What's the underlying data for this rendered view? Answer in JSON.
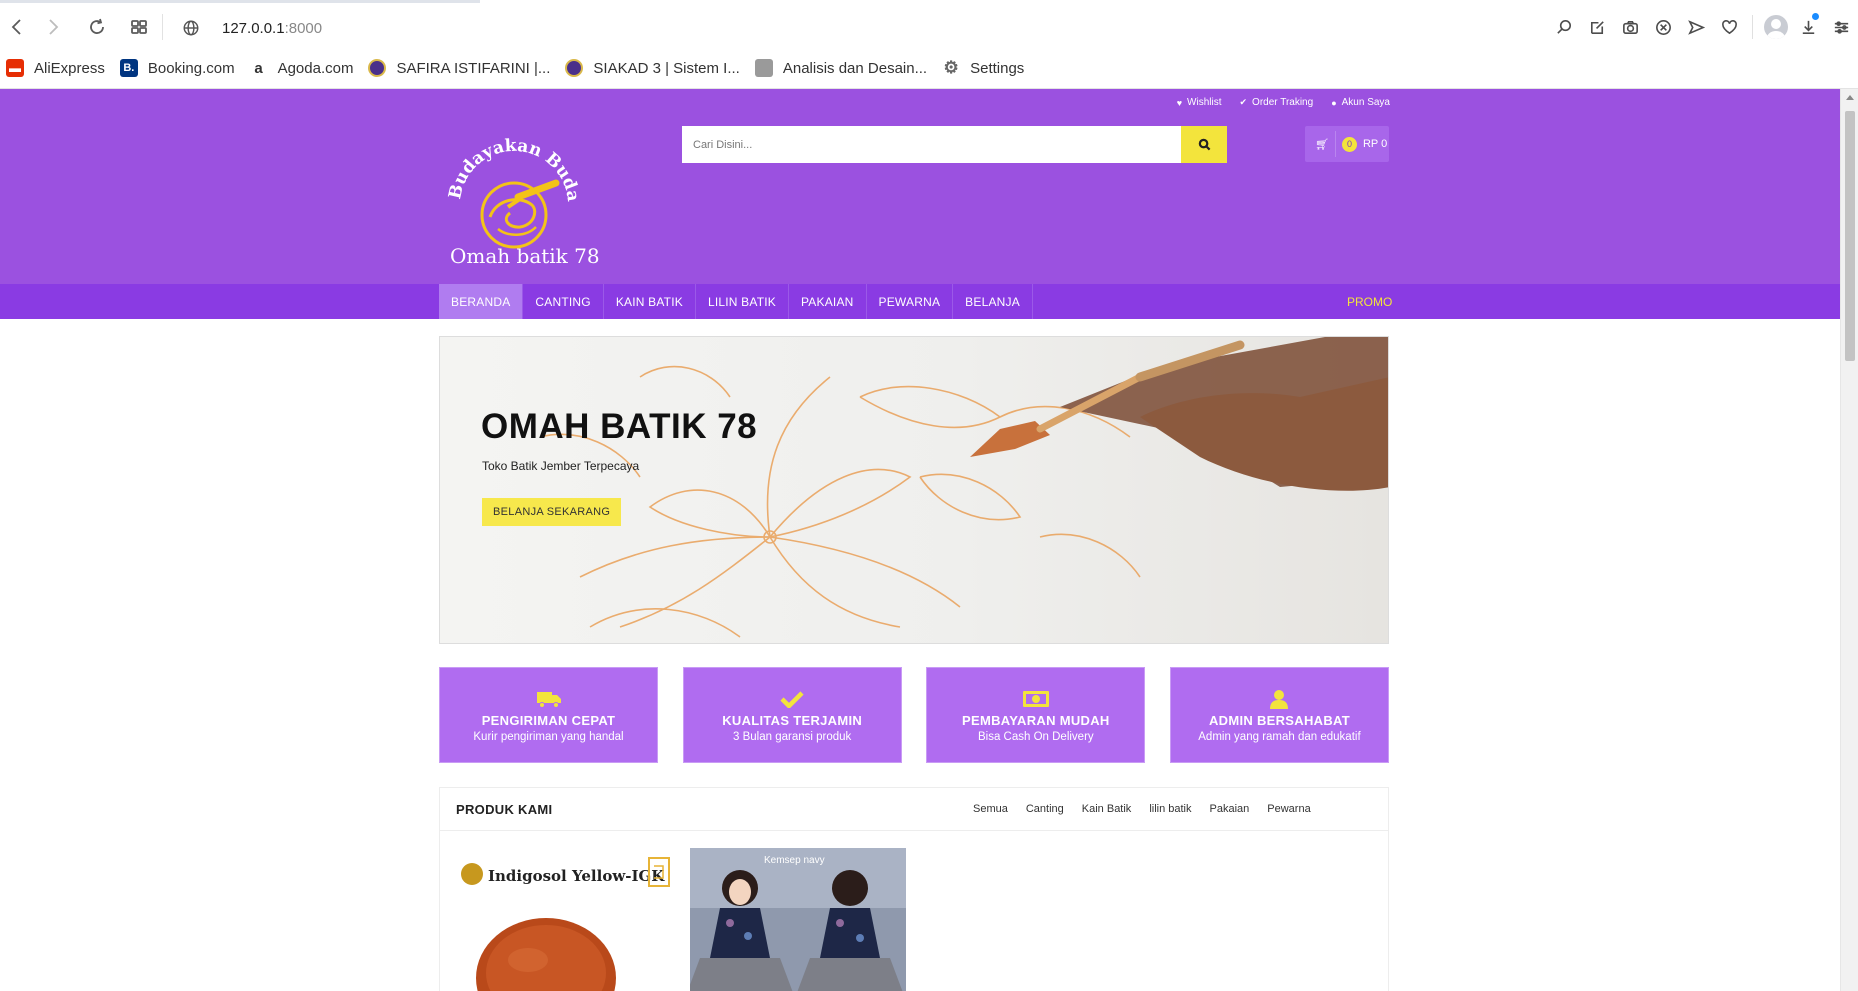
{
  "browser": {
    "address_host": "127.0.0.1",
    "address_port": ":8000",
    "bookmarks": [
      {
        "label": "AliExpress",
        "color": "#e62e04",
        "glyph": "◧"
      },
      {
        "label": "Booking.com",
        "color": "#003580",
        "glyph": "B."
      },
      {
        "label": "Agoda.com",
        "color": "#ffffff",
        "glyph": "a"
      },
      {
        "label": "SAFIRA ISTIFARINI |...",
        "color": "#3b2a7a",
        "glyph": "●"
      },
      {
        "label": "SIAKAD 3 | Sistem I...",
        "color": "#3b2a7a",
        "glyph": "●"
      },
      {
        "label": "Analisis dan Desain...",
        "color": "#9a9a9a",
        "glyph": "▤"
      },
      {
        "label": "Settings",
        "color": "#ffffff",
        "glyph": "⚙"
      }
    ]
  },
  "header": {
    "topnav": {
      "wishlist": "Wishlist",
      "order": "Order Traking",
      "account": "Akun Saya"
    },
    "search_placeholder": "Cari Disini...",
    "cart": {
      "count": "0",
      "total": "RP 0"
    },
    "logo": {
      "arc_text": "Budayakan Budaya",
      "bottom_text": "Omah batik 78"
    }
  },
  "nav": {
    "items": [
      "BERANDA",
      "CANTING",
      "KAIN BATIK",
      "LILIN BATIK",
      "PAKAIAN",
      "PEWARNA",
      "BELANJA"
    ],
    "promo": "PROMO"
  },
  "hero": {
    "title": "OMAH BATIK 78",
    "subtitle": "Toko Batik Jember Terpecaya",
    "button": "BELANJA SEKARANG"
  },
  "features": [
    {
      "title": "PENGIRIMAN CEPAT",
      "subtitle": "Kurir pengiriman yang handal",
      "icon": "truck-icon"
    },
    {
      "title": "KUALITAS TERJAMIN",
      "subtitle": "3 Bulan garansi produk",
      "icon": "check-icon"
    },
    {
      "title": "PEMBAYARAN MUDAH",
      "subtitle": "Bisa Cash On Delivery",
      "icon": "money-icon"
    },
    {
      "title": "ADMIN BERSAHABAT",
      "subtitle": "Admin yang ramah dan edukatif",
      "icon": "user-icon"
    }
  ],
  "products": {
    "title": "PRODUK KAMI",
    "filters": [
      "Semua",
      "Canting",
      "Kain Batik",
      "lilin batik",
      "Pakaian",
      "Pewarna"
    ],
    "cards": [
      {
        "label": "Indigosol Yellow-IGK"
      },
      {
        "label": "Kemsep navy"
      }
    ]
  },
  "colors": {
    "brand_purple": "#9b51e0",
    "nav_purple": "#8a3be3",
    "accent_yellow": "#f3e43c",
    "feature_purple": "#b06cf0"
  }
}
